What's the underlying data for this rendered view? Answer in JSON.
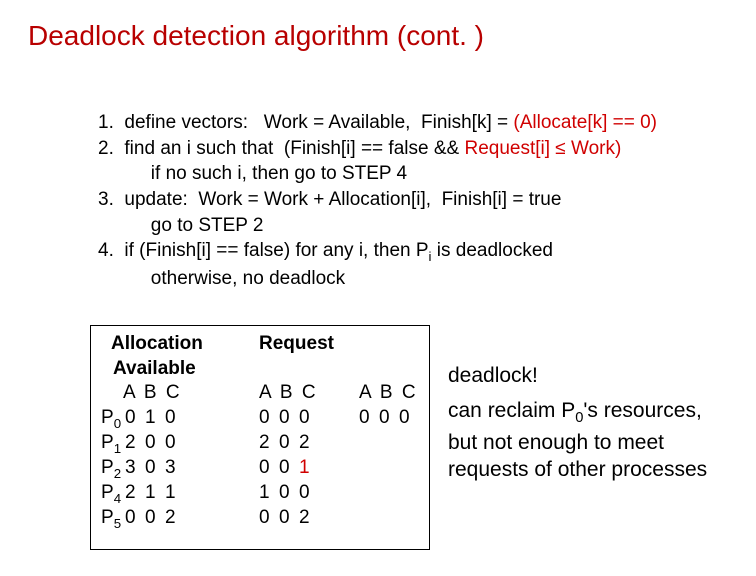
{
  "title": "Deadlock detection algorithm (cont. )",
  "steps": {
    "l1a": "1.  define vectors:   Work = Available,  Finish[k] = ",
    "l1b": "(Allocate[k] == 0)",
    "l2a": "2.  find an i such that  (Finish[i] == false && ",
    "l2b": "Request[i] ",
    "l2c": "≤",
    "l2d": " Work)",
    "l2e": "          if no such i, then go to STEP 4",
    "l3a": "3.  update:  Work = Work + Allocation[i],  Finish[i] = true",
    "l3b": "          go to STEP 2",
    "l4a": "4.  if (Finish[i] == false) for any i, then P",
    "l4b": "i",
    "l4c": " is deadlocked",
    "l4d": "          otherwise, no deadlock"
  },
  "table": {
    "hdr_alloc": "Allocation",
    "hdr_req": "Request",
    "hdr_avail": "Available",
    "abc": "A  B  C",
    "processes": [
      "P",
      "P",
      "P",
      "P",
      "P"
    ],
    "psubs": [
      "0",
      "1",
      "2",
      "4",
      "5"
    ],
    "alloc": [
      [
        "0",
        "1",
        "0"
      ],
      [
        "2",
        "0",
        "0"
      ],
      [
        "3",
        "0",
        "3"
      ],
      [
        "2",
        "1",
        "1"
      ],
      [
        "0",
        "0",
        "2"
      ]
    ],
    "req": [
      [
        "0",
        "0",
        "0"
      ],
      [
        "2",
        "0",
        "2"
      ],
      [
        "0",
        "0",
        "1"
      ],
      [
        "1",
        "0",
        "0"
      ],
      [
        "0",
        "0",
        "2"
      ]
    ],
    "req_red_col": [
      null,
      null,
      2,
      null,
      null
    ],
    "avail": [
      "0",
      "0",
      "0"
    ]
  },
  "side": {
    "dl": "deadlock!",
    "t1": "can reclaim P",
    "t1s": "0",
    "t2": "'s resources, but not enough to meet requests of other processes"
  }
}
